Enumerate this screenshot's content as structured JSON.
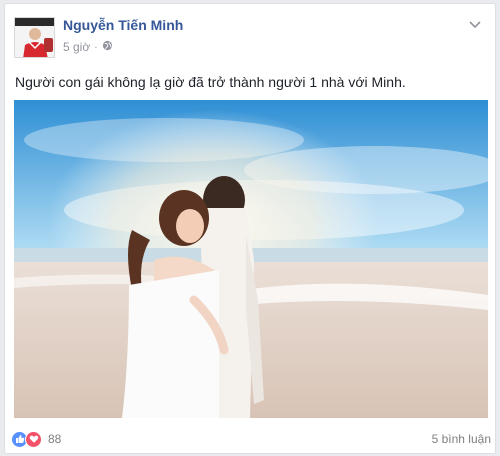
{
  "post": {
    "author": "Nguyễn Tiến Minh",
    "time": "5 giờ",
    "privacy_icon": "globe-icon",
    "caption": "Người con gái không lạ giờ đã trở thành người 1 nhà với Minh.",
    "photo_icon": "beach-couple-photo"
  },
  "footer": {
    "reaction_icons": [
      "like-icon",
      "love-icon"
    ],
    "reaction_count": "88",
    "comments": "5 bình luận"
  },
  "colors": {
    "author": "#365899",
    "like": "#5890ff",
    "love": "#f25268"
  }
}
